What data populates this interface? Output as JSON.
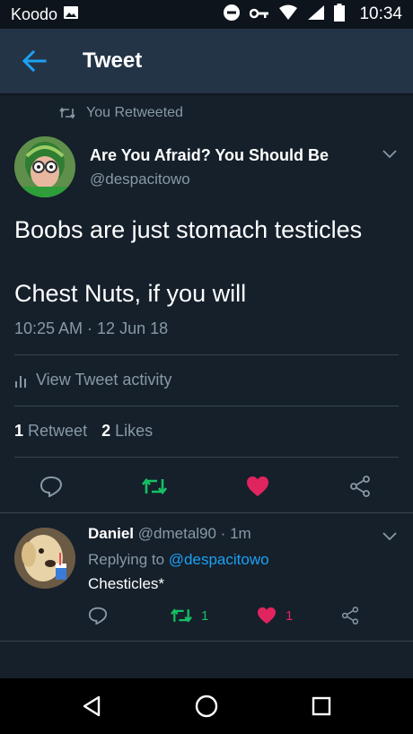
{
  "status_bar": {
    "carrier": "Koodo",
    "time": "10:34",
    "icons": [
      "image-icon",
      "do-not-disturb-icon",
      "vpn-key-icon",
      "wifi-icon",
      "signal-icon",
      "battery-icon"
    ]
  },
  "header": {
    "title": "Tweet"
  },
  "retweet_context": "You Retweeted",
  "tweet": {
    "display_name": "Are You Afraid? You Should Be",
    "handle": "@despacitowo",
    "lines": [
      "Boobs are just stomach testicles",
      "Chest Nuts, if you will"
    ],
    "timestamp": "10:25 AM · 12 Jun 18",
    "activity_label": "View Tweet activity",
    "retweet_count": "1",
    "retweet_label": "Retweet",
    "like_count": "2",
    "like_label": "Likes"
  },
  "reply": {
    "display_name": "Daniel",
    "handle_time": "@dmetal90 · 1m",
    "replying_prefix": "Replying to",
    "replying_handle": "@despacitowo",
    "text": "Chesticles*",
    "retweet_count": "1",
    "like_count": "1"
  },
  "colors": {
    "background": "#15202b",
    "header": "#243447",
    "muted": "#8899a6",
    "accent": "#1da1f2",
    "retweet": "#17bf63",
    "like": "#e0245e"
  }
}
